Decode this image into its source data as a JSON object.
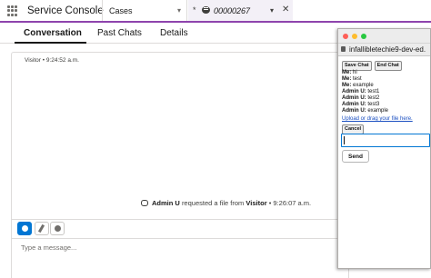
{
  "topbar": {
    "app_name": "Service Console",
    "nav_selector": "Cases",
    "workspace_tab": {
      "modified_mark": "*",
      "record_number": "00000267"
    }
  },
  "subtabs": [
    "Conversation",
    "Past Chats",
    "Details"
  ],
  "conversation": {
    "visitor_meta": "Visitor • 9:24:52 a.m.",
    "file_event": {
      "actor": "Admin U",
      "text": "requested a file from",
      "target": "Visitor",
      "time": "• 9:26:07 a.m."
    },
    "composer_placeholder": "Type a message..."
  },
  "popup": {
    "url": "infallibletechie9-dev-ed.",
    "save_chat_label": "Save Chat",
    "end_chat_label": "End Chat",
    "log": [
      {
        "sender": "Me:",
        "message": "hi"
      },
      {
        "sender": "Me:",
        "message": "test"
      },
      {
        "sender": "Me:",
        "message": "example"
      },
      {
        "sender": "Admin U:",
        "message": "test1"
      },
      {
        "sender": "Admin U:",
        "message": "test2"
      },
      {
        "sender": "Admin U:",
        "message": "test3"
      },
      {
        "sender": "Admin U:",
        "message": "example"
      }
    ],
    "upload_link": "Upload or drag your file here.",
    "cancel_label": "Cancel",
    "send_label": "Send"
  },
  "colors": {
    "accent": "#8e44ad",
    "brand_blue": "#0176d3",
    "link": "#1a4fc1"
  }
}
